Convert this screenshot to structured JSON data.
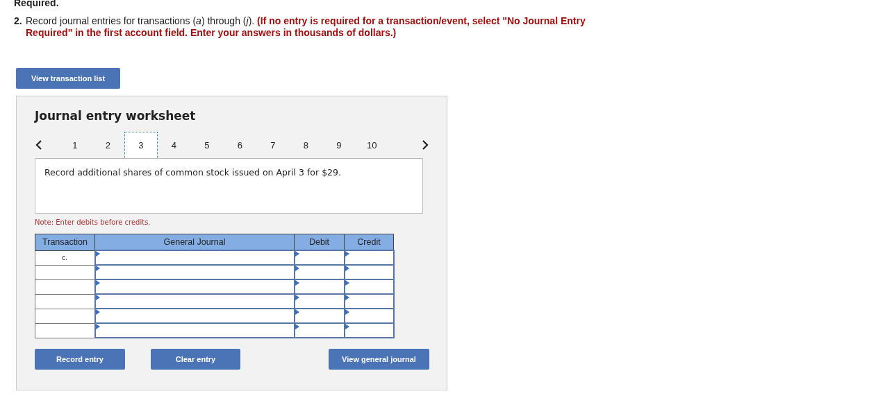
{
  "heading": "Required.",
  "instruction": {
    "number": "2.",
    "text": "Record journal entries for transactions (*a*) through (*j*). **(If no entry is required for a transaction/event, select \"No Journal Entry Required\" in the first account field. Enter your answers in thousands of dollars.)**"
  },
  "view_transactions_button": "View transaction list",
  "worksheet": {
    "title": "Journal entry worksheet",
    "pages": [
      {
        "label": "1",
        "selected": false
      },
      {
        "label": "2",
        "selected": false
      },
      {
        "label": "3",
        "selected": true
      },
      {
        "label": "4",
        "selected": false
      },
      {
        "label": "5",
        "selected": false
      },
      {
        "label": "6",
        "selected": false
      },
      {
        "label": "7",
        "selected": false
      },
      {
        "label": "8",
        "selected": false
      },
      {
        "label": "9",
        "selected": false
      },
      {
        "label": "10",
        "selected": false
      }
    ],
    "description": "Record additional shares of common stock issued on April 3 for $29.",
    "note": "Note: Enter debits before credits.",
    "table": {
      "columns": [
        "Transaction",
        "General Journal",
        "Debit",
        "Credit"
      ],
      "rows": [
        {
          "transaction": "c."
        },
        {},
        {},
        {},
        {},
        {}
      ]
    },
    "buttons": [
      "Record entry",
      "Clear entry",
      "View general journal"
    ]
  }
}
